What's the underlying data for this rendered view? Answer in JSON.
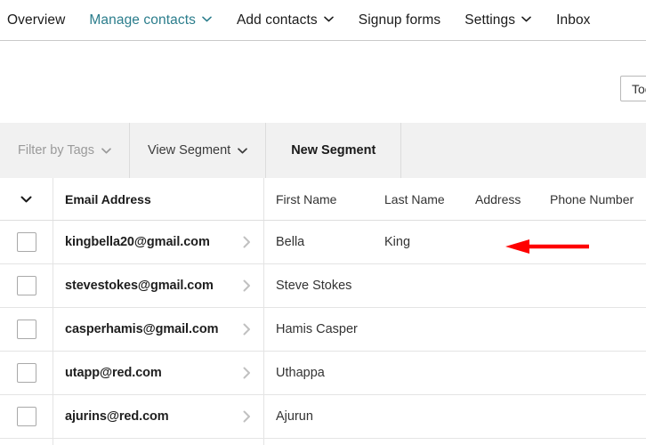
{
  "nav": {
    "items": [
      {
        "label": "Overview",
        "has_caret": false,
        "active": false
      },
      {
        "label": "Manage contacts",
        "has_caret": true,
        "active": true
      },
      {
        "label": "Add contacts",
        "has_caret": true,
        "active": false
      },
      {
        "label": "Signup forms",
        "has_caret": false,
        "active": false
      },
      {
        "label": "Settings",
        "has_caret": true,
        "active": false
      },
      {
        "label": "Inbox",
        "has_caret": false,
        "active": false
      }
    ],
    "active_color": "#2b7d8c",
    "text_color": "#1a1a1a"
  },
  "toolbar": {
    "tools_label": "Tools"
  },
  "segments": {
    "tabs": [
      {
        "label": "Filter by Tags",
        "has_caret": true,
        "state": "muted"
      },
      {
        "label": "View Segment",
        "has_caret": true,
        "state": "normal"
      },
      {
        "label": "New Segment",
        "has_caret": false,
        "state": "active"
      }
    ]
  },
  "table": {
    "headers": {
      "select_all_icon": "chevron-down-icon",
      "email": "Email Address",
      "first_name": "First Name",
      "last_name": "Last Name",
      "address": "Address",
      "phone": "Phone Number"
    },
    "rows": [
      {
        "email": "kingbella20@gmail.com",
        "first_name": "Bella",
        "last_name": "King",
        "address": "",
        "phone": ""
      },
      {
        "email": "stevestokes@gmail.com",
        "first_name": "Steve Stokes",
        "last_name": "",
        "address": "",
        "phone": ""
      },
      {
        "email": "casperhamis@gmail.com",
        "first_name": "Hamis Casper",
        "last_name": "",
        "address": "",
        "phone": ""
      },
      {
        "email": "utapp@red.com",
        "first_name": "Uthappa",
        "last_name": "",
        "address": "",
        "phone": ""
      },
      {
        "email": "ajurins@red.com",
        "first_name": "Ajurun",
        "last_name": "",
        "address": "",
        "phone": ""
      }
    ]
  },
  "annotation": {
    "arrow_color": "#fe0000",
    "direction": "left",
    "points_at": "address-column-of-first-row"
  }
}
